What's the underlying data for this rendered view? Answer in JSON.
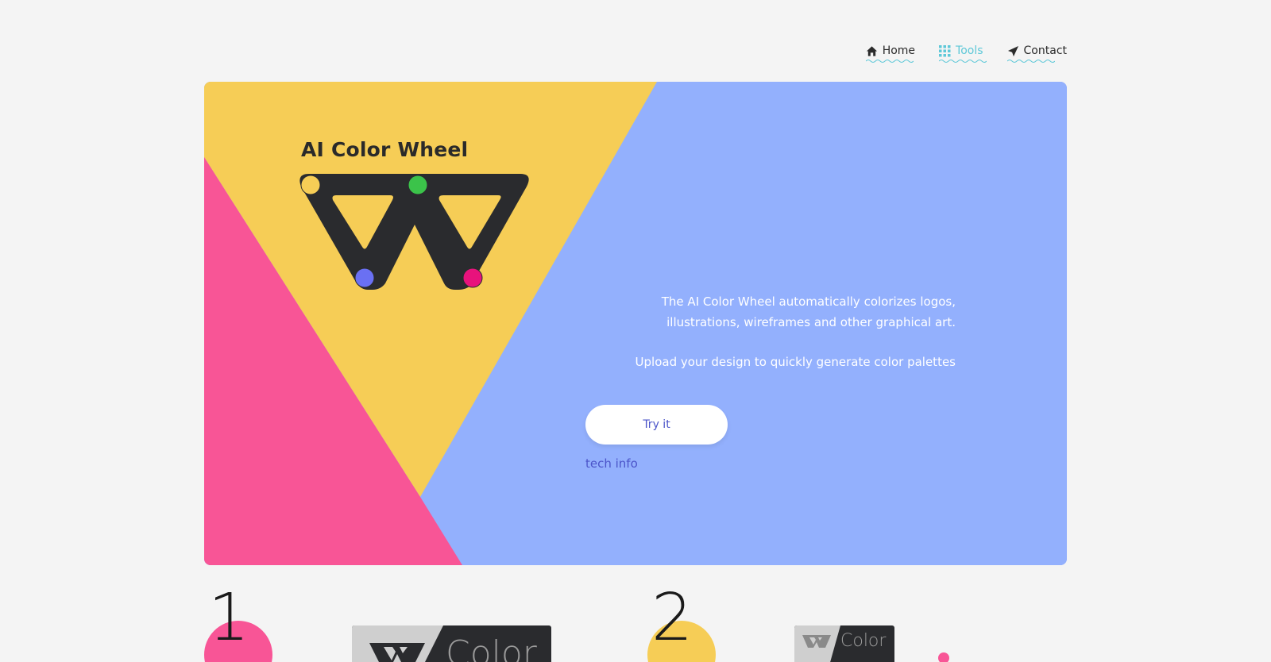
{
  "nav": {
    "items": [
      {
        "label": "Home",
        "icon": "home-icon"
      },
      {
        "label": "Tools",
        "icon": "grid-icon",
        "active": true
      },
      {
        "label": "Contact",
        "icon": "paper-plane-icon"
      }
    ]
  },
  "hero": {
    "title": "AI Color Wheel",
    "description_1": "The AI Color Wheel automatically colorizes logos, illustrations, wireframes and other graphical art.",
    "description_2": "Upload your design to quickly generate color palettes",
    "try_button_label": "Try it",
    "tech_link_label": "tech info"
  },
  "steps": [
    {
      "number": "1",
      "thumb_text": "Color"
    },
    {
      "number": "2",
      "thumb_text": "Color"
    }
  ],
  "colors": {
    "background": "#f4f4f4",
    "hero_blue": "#93b0fd",
    "hero_yellow": "#f6cd56",
    "hero_pink": "#f85596",
    "logo_dark": "#2a2b2e",
    "dot_yellow": "#f6cd56",
    "dot_green": "#3bc34a",
    "dot_blue": "#6a70f3",
    "dot_pink": "#e8127c",
    "accent_teal": "#5ec8d8",
    "link_blue": "#4b54c9"
  }
}
